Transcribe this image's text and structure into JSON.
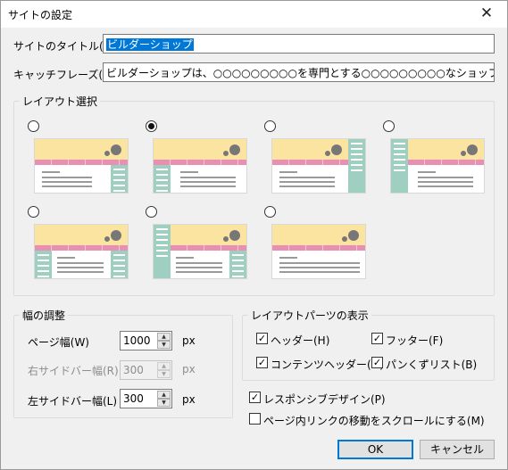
{
  "window": {
    "title": "サイトの設定",
    "close_glyph": "✕"
  },
  "site": {
    "title_label": "サイトのタイトル(T)",
    "title_value": "ビルダーショップ",
    "catch_label": "キャッチフレーズ(C)",
    "catch_value": "ビルダーショップは、○○○○○○○○○を専門とする○○○○○○○○○なショップです。"
  },
  "layout": {
    "legend": "レイアウト選択",
    "selected_index": 1,
    "options": [
      {
        "name": "header-nav-main-sidebar-right"
      },
      {
        "name": "header-nav-sidebar-left-main"
      },
      {
        "name": "header-nav-main-sidebar-right-full"
      },
      {
        "name": "sidebar-left-full-header-nav-main"
      },
      {
        "name": "header-nav-two-sidebars"
      },
      {
        "name": "sidebar-left-full-header-nav-main-sidebar-right"
      },
      {
        "name": "header-nav-main-only"
      }
    ]
  },
  "width": {
    "legend": "幅の調整",
    "page_label": "ページ幅(W)",
    "page_value": "1000",
    "right_label": "右サイドバー幅(R)",
    "right_value": "300",
    "right_enabled": false,
    "left_label": "左サイドバー幅(L)",
    "left_value": "300",
    "unit": "px"
  },
  "parts": {
    "legend": "レイアウトパーツの表示",
    "header": "ヘッダー(H)",
    "footer": "フッター(F)",
    "content_header": "コンテンツヘッダー(O)",
    "breadcrumb": "パンくずリスト(B)"
  },
  "options": {
    "responsive": "レスポンシブデザイン(P)",
    "smooth_scroll": "ページ内リンクの移動をスクロールにする(M)"
  },
  "buttons": {
    "ok": "OK",
    "cancel": "キャンセル"
  },
  "colors": {
    "header": "#fbe4a0",
    "nav": "#e98fb4",
    "sidebar": "#9fcfc0",
    "accent": "#0078d7"
  }
}
